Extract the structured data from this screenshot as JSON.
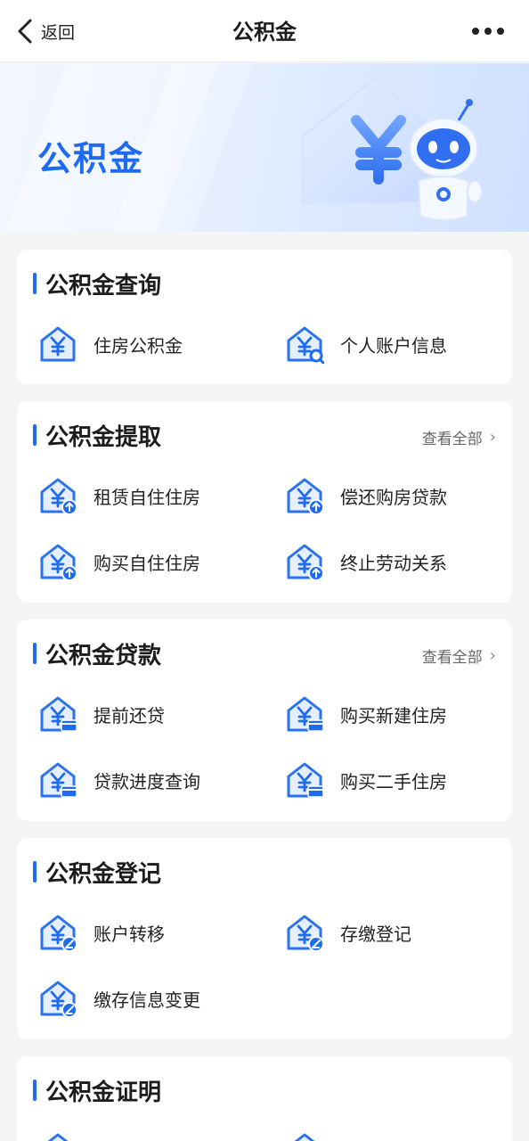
{
  "nav": {
    "back_label": "返回",
    "title": "公积金"
  },
  "banner": {
    "title": "公积金"
  },
  "sections": [
    {
      "title": "公积金查询",
      "items": [
        "住房公积金",
        "个人账户信息"
      ]
    },
    {
      "title": "公积金提取",
      "more": "查看全部",
      "items": [
        "租赁自住住房",
        "偿还购房贷款",
        "购买自住住房",
        "终止劳动关系"
      ]
    },
    {
      "title": "公积金贷款",
      "more": "查看全部",
      "items": [
        "提前还贷",
        "购买新建住房",
        "贷款进度查询",
        "购买二手住房"
      ]
    },
    {
      "title": "公积金登记",
      "items": [
        "账户转移",
        "存缴登记",
        "缴存信息变更"
      ]
    },
    {
      "title": "公积金证明"
    }
  ],
  "colors": {
    "accent": "#1e6bef",
    "icon_light": "#e6efff"
  }
}
